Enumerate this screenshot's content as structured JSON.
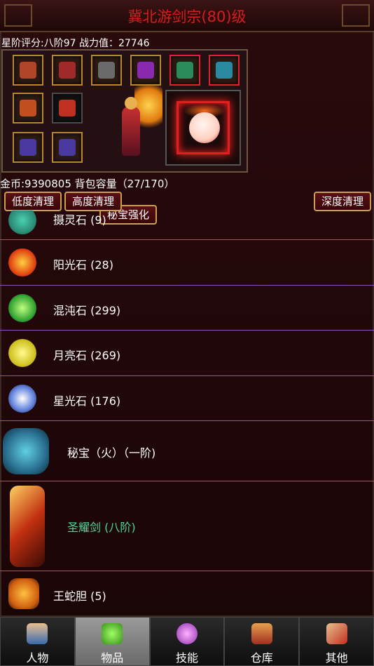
{
  "title": "冀北游剑宗(80)级",
  "stats": "星阶评分:八阶97 战力值：27746",
  "equip": {
    "enhance_label": "秘宝强化"
  },
  "coins": "金币:9390805 背包容量（27/170）",
  "buttons": {
    "low_clean": "低度清理",
    "high_clean": "高度清理",
    "deep_clean": "深度清理"
  },
  "items": [
    {
      "label": "摄灵石 (9)",
      "color": "#2fa890"
    },
    {
      "label": "阳光石 (28)",
      "color": "#ff6a1a"
    },
    {
      "label": "混沌石 (299)",
      "color": "#4cd24c"
    },
    {
      "label": "月亮石 (269)",
      "color": "#e8e030"
    },
    {
      "label": "星光石 (176)",
      "color": "#6a8ae0"
    },
    {
      "label": "秘宝（火）（一阶)",
      "color": "#2a90a8"
    },
    {
      "label": "圣耀剑 (八阶)",
      "color": "#c8401a",
      "label_color": "#4fd89a"
    },
    {
      "label": "王蛇胆 (5)",
      "color": "#e88a1a"
    }
  ],
  "nav": [
    {
      "label": "人物",
      "icon": "character-icon",
      "color": "#3a6ab0"
    },
    {
      "label": "物品",
      "icon": "potion-icon",
      "color": "#58b040"
    },
    {
      "label": "技能",
      "icon": "skill-orb-icon",
      "color": "#b040c0"
    },
    {
      "label": "仓库",
      "icon": "warehouse-icon",
      "color": "#c05030"
    },
    {
      "label": "其他",
      "icon": "crossed-swords-icon",
      "color": "#c04030"
    }
  ],
  "active_tab": "物品"
}
